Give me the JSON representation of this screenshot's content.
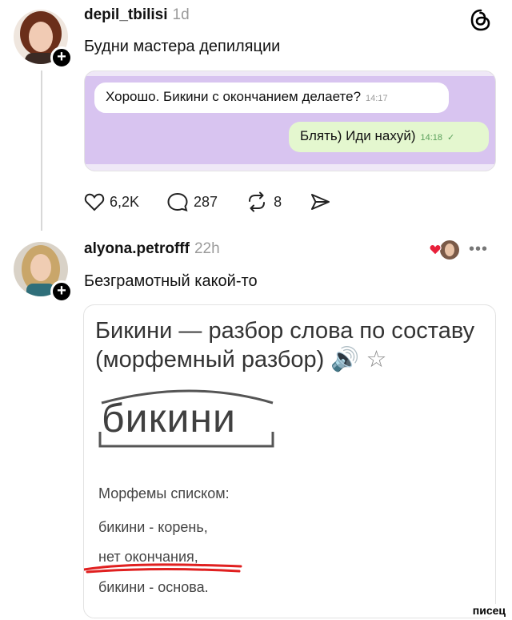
{
  "post1": {
    "username": "depil_tbilisi",
    "time": "1d",
    "text": "Будни мастера депиляции",
    "chat": {
      "incoming": {
        "text": "Хорошо. Бикини с окончанием делаете?",
        "time": "14:17"
      },
      "outgoing": {
        "text": "Блять) Иди нахуй)",
        "time": "14:18",
        "status": "✓"
      }
    },
    "actions": {
      "likes": "6,2K",
      "comments": "287",
      "reposts": "8"
    },
    "icons": [
      "threads-logo-icon",
      "heart-icon",
      "comment-icon",
      "repost-icon",
      "share-icon",
      "plus-icon"
    ]
  },
  "post2": {
    "username": "alyona.petrofff",
    "time": "22h",
    "text": "Безграмотный какой-то",
    "more": "•••",
    "embedded": {
      "title": "Бикини — разбор слова по составу (морфемный разбор)",
      "title_emoji": "🔊 ☆",
      "word": "бикини",
      "morph_heading": "Морфемы списком:",
      "morph_items": [
        "бикини - корень,",
        "нет окончания,",
        "бикини - основа."
      ]
    }
  },
  "watermark": "писец",
  "colors": {
    "chat_bg": "#d8c4f0",
    "incoming_bubble": "#ffffff",
    "outgoing_bubble": "#e4f7cf",
    "underline_red": "#e02020"
  }
}
